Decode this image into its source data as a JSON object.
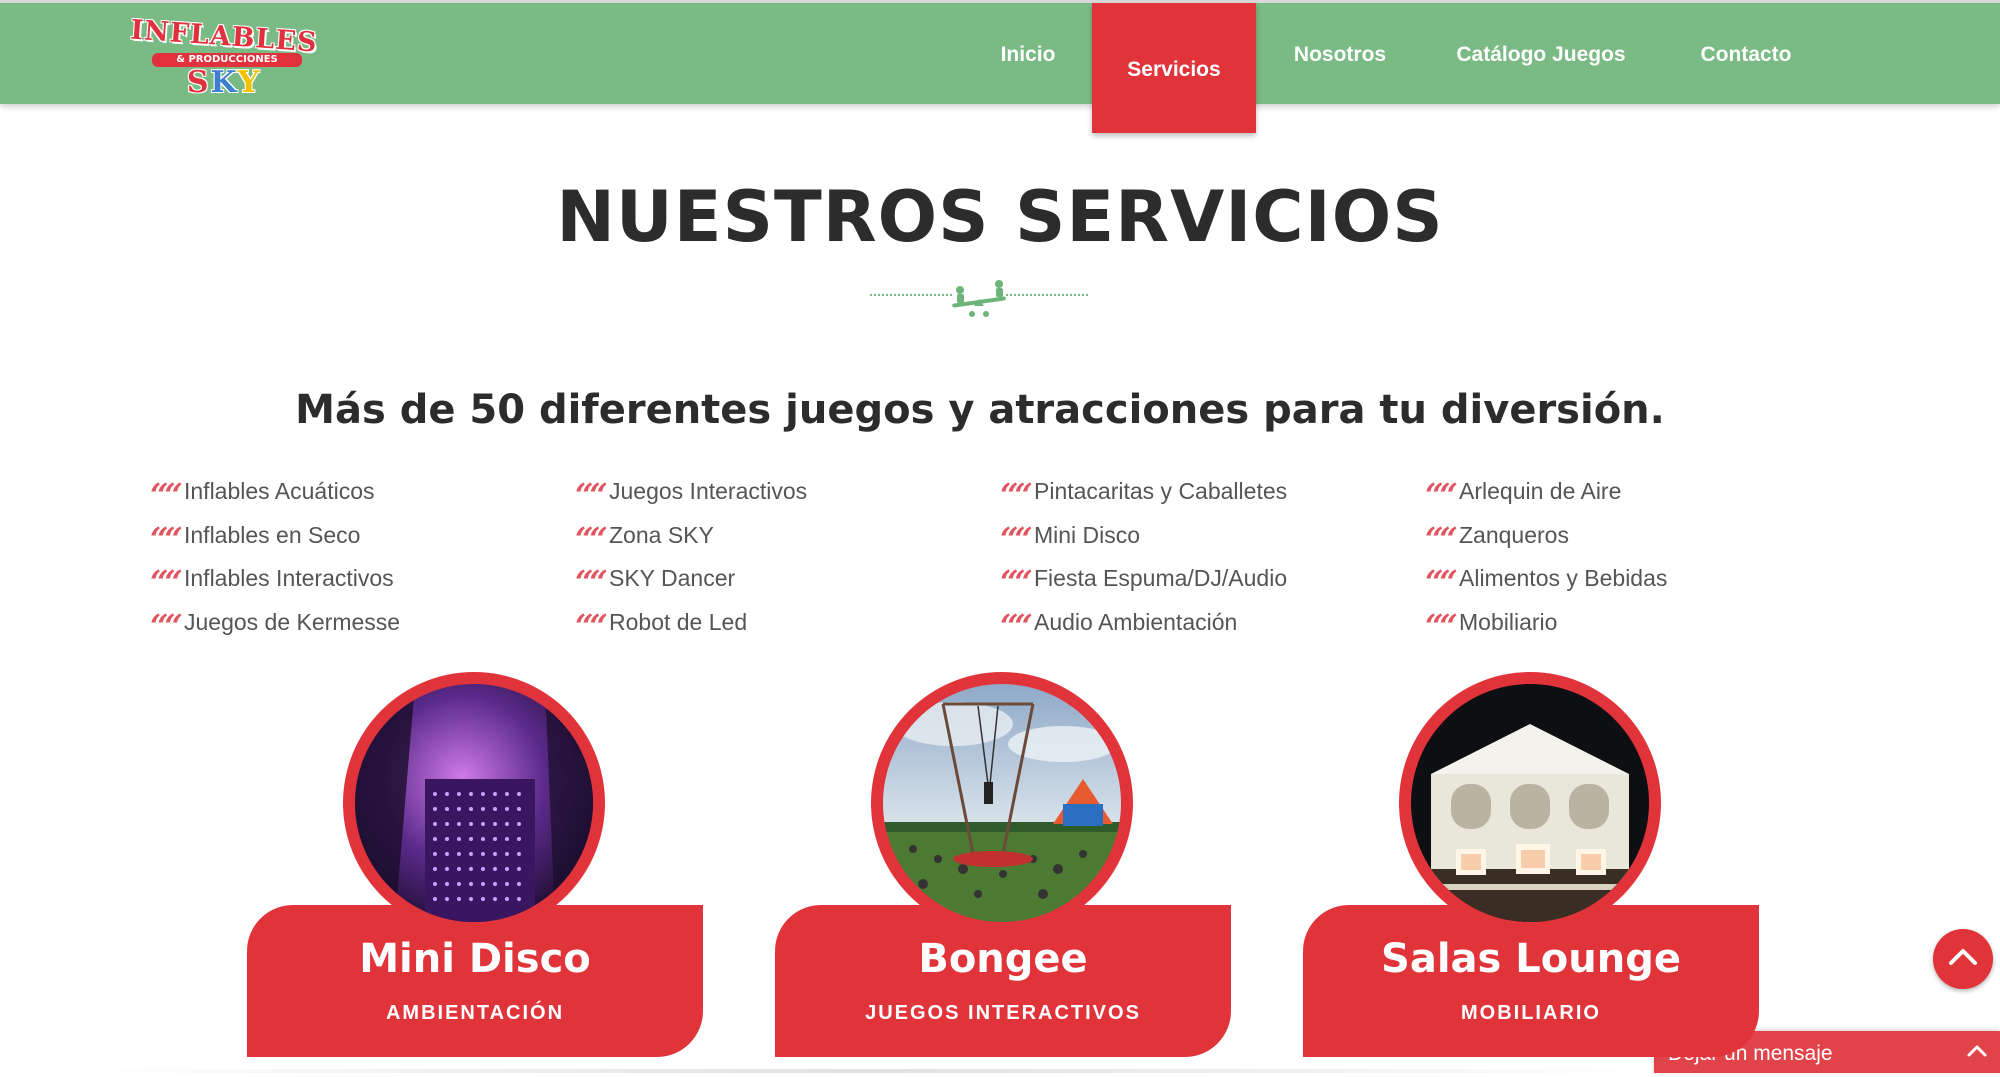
{
  "logo": {
    "line1": "INFLABLES",
    "line2": "& PRODUCCIONES",
    "sky": [
      "S",
      "K",
      "Y"
    ]
  },
  "nav": {
    "items": [
      "Inicio",
      "Servicios",
      "Nosotros",
      "Catálogo Juegos",
      "Contacto"
    ],
    "active": "Servicios"
  },
  "main": {
    "title": "NUESTROS SERVICIOS",
    "divider_icon": "seesaw-icon",
    "subtitle": "Más de 50 diferentes juegos y atracciones para tu diversión.",
    "services": [
      [
        "Inflables Acuáticos",
        "Inflables en Seco",
        "Inflables Interactivos",
        "Juegos de Kermesse"
      ],
      [
        "Juegos Interactivos",
        "Zona SKY",
        "SKY Dancer",
        "Robot de Led"
      ],
      [
        "Pintacaritas y Caballetes",
        "Mini Disco",
        "Fiesta Espuma/DJ/Audio",
        "Audio Ambientación"
      ],
      [
        "Arlequin de Aire",
        "Zanqueros",
        "Alimentos y Bebidas",
        "Mobiliario"
      ]
    ],
    "cards": [
      {
        "name": "Mini Disco",
        "category": "AMBIENTACIÓN"
      },
      {
        "name": "Bongee",
        "category": "JUEGOS INTERACTIVOS"
      },
      {
        "name": "Salas Lounge",
        "category": "MOBILIARIO"
      }
    ]
  },
  "widgets": {
    "scroll_top_icon": "chevron-up-icon",
    "chat_label": "Dejar un mensaje"
  },
  "colors": {
    "header": "#7aba84",
    "accent": "#e1343a",
    "text": "#2c2c2c"
  }
}
